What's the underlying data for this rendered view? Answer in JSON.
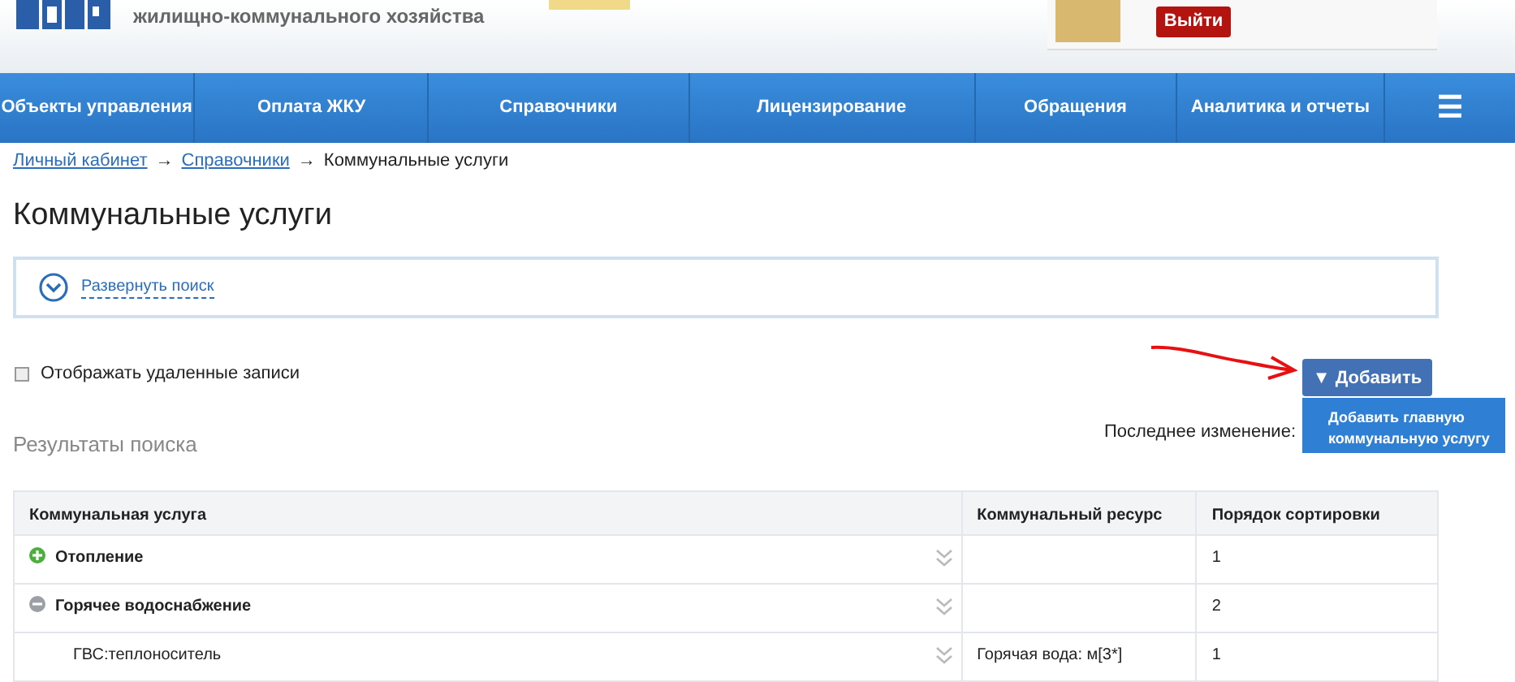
{
  "header": {
    "subtitle": "жилищно-коммунального хозяйства",
    "logout_button": "Выйти"
  },
  "nav": [
    {
      "label": "Объекты управления",
      "selected": false
    },
    {
      "label": "Оплата ЖКУ",
      "selected": false
    },
    {
      "label": "Справочники",
      "selected": false
    },
    {
      "label": "Лицензирование",
      "selected": false
    },
    {
      "label": "Обращения",
      "selected": false
    },
    {
      "label": "Аналитика и отчеты",
      "selected": false
    },
    {
      "label": "☰",
      "selected": false
    }
  ],
  "breadcrumbs": [
    {
      "label": "Личный кабинет",
      "link": true
    },
    {
      "label": "Справочники",
      "link": true
    },
    {
      "label": "Коммунальные услуги",
      "link": false
    }
  ],
  "breadcrumb_separator": "→",
  "page_title": "Коммунальные услуги",
  "search_panel": {
    "toggle": "Развернуть поиск",
    "expanded": false
  },
  "show_deleted": {
    "label": "Отображать удаленные записи",
    "checked": false
  },
  "add_button": {
    "label": "Добавить",
    "caret": "▼",
    "menu": [
      "Добавить главную коммунальную услугу"
    ]
  },
  "results_title": "Результаты поиска",
  "last_change_label": "Последнее изменение:",
  "table": {
    "columns": [
      "Коммунальная услуга",
      "Коммунальный ресурс",
      "Порядок сортировки"
    ],
    "rows": [
      {
        "service": "Отопление",
        "resource": "",
        "order": "1",
        "expanded": false,
        "children": []
      },
      {
        "service": "Горячее водоснабжение",
        "resource": "",
        "order": "2",
        "expanded": true,
        "children": [
          {
            "service": "ГВС:теплоноситель",
            "resource": "Горячая вода: м[3*]",
            "order": "1"
          }
        ]
      }
    ]
  }
}
